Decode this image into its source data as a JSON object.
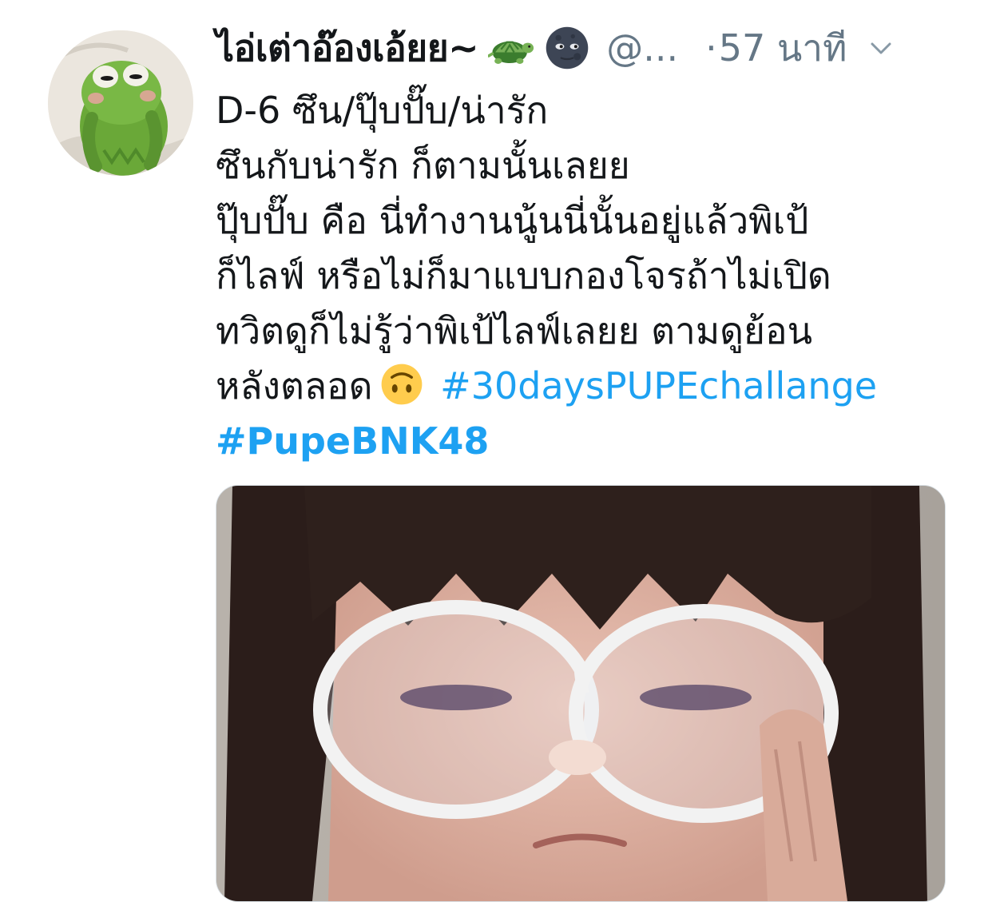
{
  "tweet": {
    "display_name": "ไอ่เต่าอ๊องเอ้ยย~",
    "handle": "@...",
    "separator": "·",
    "timestamp": "57 นาที",
    "lines": [
      "D-6 ซึน/ปุ๊บปั๊บ/น่ารัก",
      "ซึนกับน่ารัก ก็ตามนั้นเลยย",
      "ปุ๊บปั๊บ คือ นี่ทำงานนู้นนี่นั้นอยู่แล้วพิเป้",
      "ก็ไลฟ์ หรือไม่ก็มาแบบกองโจรถ้าไม่เปิด",
      "ทวิตดูก็ไม่รู้ว่าพิเป้ไลฟ์เลยย ตามดูย้อน",
      "หลังตลอด"
    ],
    "hashtags": [
      "#30daysPUPEchallange",
      "#PupeBNK48"
    ],
    "icons": {
      "avatar": "kermit-avatar",
      "name_emoji_1": "turtle-emoji",
      "name_emoji_2": "new-moon-face-emoji",
      "inline_emoji": "upside-down-face-emoji",
      "menu": "chevron-down-icon"
    },
    "colors": {
      "text": "#14171a",
      "secondary": "#657786",
      "link": "#1da1f2"
    }
  }
}
